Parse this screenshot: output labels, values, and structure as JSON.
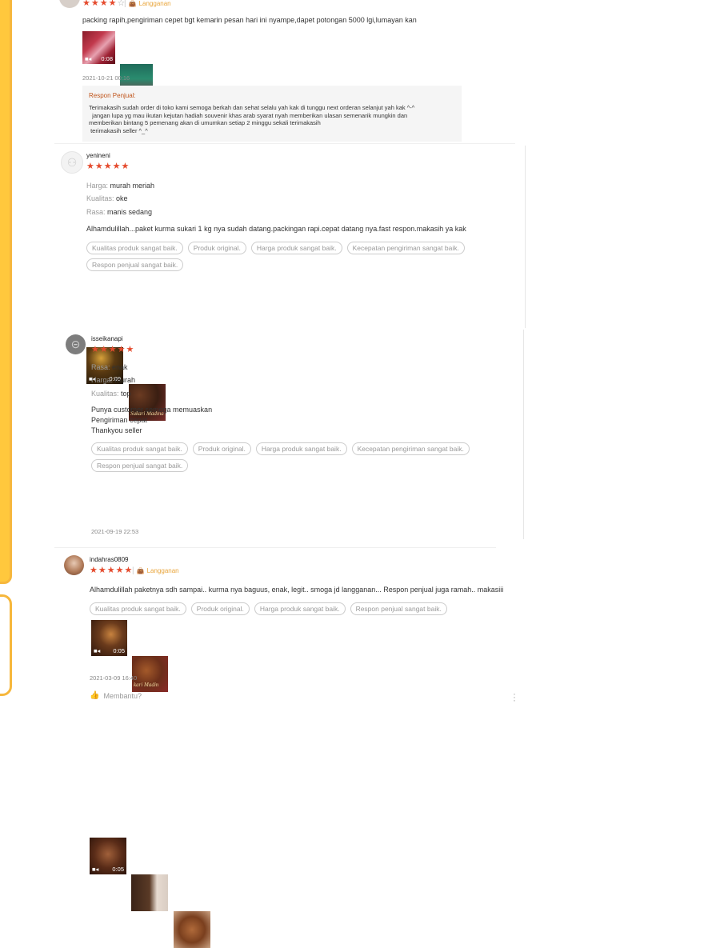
{
  "r0": {
    "stars": 4,
    "badge": "Langganan",
    "text": "packing rapih,pengiriman cepet bgt kemarin pesan hari ini nyampe,dapet potongan 5000 lgi,lumayan kan",
    "video_duration": "0:08",
    "date": "2021-10-21 00:16",
    "response_title": "Respon Penjual:",
    "response_text": "Terimakasih sudah order di toko kami semoga berkah dan sehat selalu yah kak di tunggu next orderan selanjut yah kak ^-^\n  jangan lupa yg mau ikutan kejutan hadiah souvenir khas arab syarat nyah memberikan ulasan semenarik mungkin dan\nmemberikan bintang 5 pemenang akan di umumkan setiap 2 minggu sekali terimakasih\n terimakasih seller ^_^"
  },
  "r1": {
    "user": "yenineni",
    "stars": 5,
    "attrs": [
      {
        "k": "Harga:",
        "v": "murah meriah"
      },
      {
        "k": "Kualitas:",
        "v": "oke"
      },
      {
        "k": "Rasa:",
        "v": "manis sedang"
      }
    ],
    "text": "Alhamdulillah...paket kurma sukari 1 kg nya sudah datang.packingan rapi.cepat datang nya.fast respon.makasih ya kak",
    "tags": [
      "Kualitas produk sangat baik.",
      "Produk original.",
      "Harga produk sangat baik.",
      "Kecepatan pengiriman sangat baik.",
      "Respon penjual sangat baik."
    ],
    "video_duration": "0:09",
    "thumb_label": "Sukari Madina"
  },
  "r2": {
    "user": "isseikanapi",
    "stars": 5,
    "attrs": [
      {
        "k": "Rasa:",
        "v": "enak"
      },
      {
        "k": "Harga:",
        "v": "murah"
      },
      {
        "k": "Kualitas:",
        "v": "top"
      }
    ],
    "text_lines": [
      "Punya customer semoga memuaskan",
      "Pengiriman cepat",
      "Thankyou seller"
    ],
    "tags": [
      "Kualitas produk sangat baik.",
      "Produk original.",
      "Harga produk sangat baik.",
      "Kecepatan pengiriman sangat baik.",
      "Respon penjual sangat baik."
    ],
    "video_duration": "0:05",
    "thumb_label": "kari Madin",
    "date": "2021-09-19 22:53"
  },
  "r3": {
    "user": "indahras0809",
    "stars": 5,
    "badge": "Langganan",
    "text": "Alhamdulillah paketnya sdh sampai.. kurma nya baguus, enak, legit.. smoga jd langganan... Respon penjual juga ramah.. makasiii",
    "tags": [
      "Kualitas produk sangat baik.",
      "Produk original.",
      "Harga produk sangat baik.",
      "Respon penjual sangat baik."
    ],
    "video_duration": "0:05",
    "date": "2021-03-09 16:40",
    "helpful": "Membantu?"
  },
  "colors": {
    "star": "#e54b2e",
    "badge": "#e9a53b",
    "response_title": "#c0541a",
    "yellow": "#ffc83d"
  }
}
